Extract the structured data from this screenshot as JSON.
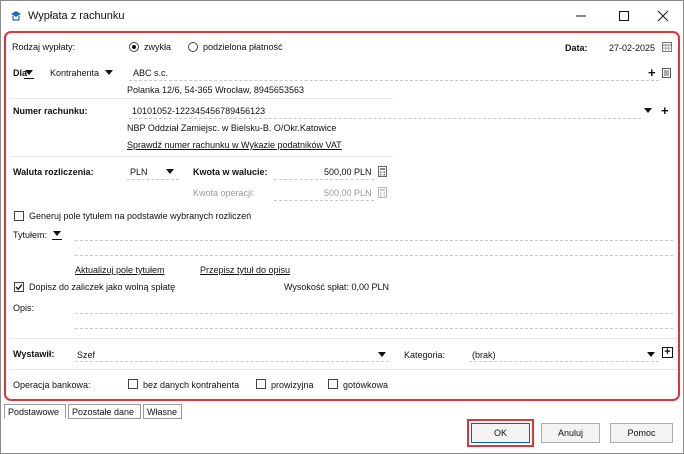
{
  "window": {
    "title": "Wypłata z rachunku"
  },
  "form": {
    "payment_type_label": "Rodzaj wypłaty:",
    "payment_type_options": [
      "zwykła",
      "podzielona płatność"
    ],
    "date_label": "Data:",
    "date_value": "27-02-2025",
    "for_label": "Dla",
    "party_type": "Kontrahenta",
    "party_name": "ABC s.c.",
    "party_address": "Polanka  12/6, 54-365 Wrocław, 8945653563",
    "account_label": "Numer rachunku:",
    "account_number": "10101052-122345456789456123",
    "bank_name": "NBP Oddział Zamiejsc. w Bielsku-B.  O/Okr.Katowice",
    "vat_check_link": "Sprawdź numer rachunku w Wykazie podatników VAT",
    "currency_label": "Waluta rozliczenia:",
    "currency_value": "PLN",
    "amount_label": "Kwota w walucie:",
    "amount_value": "500,00 PLN",
    "operation_amount_label": "Kwota operacji:",
    "operation_amount_value": "500,00 PLN",
    "generate_title_label": "Generuj pole tytułem na podstawie wybranych rozliczeń",
    "title_label": "Tytułem:",
    "update_title_link": "Aktualizuj pole tytułem",
    "copy_title_link": "Przepisz tytuł do opisu",
    "add_to_advances_label": "Dopisz do zaliczek jako wolną spłatę",
    "repayment_label": "Wysokość spłat: 0,00 PLN",
    "description_label": "Opis:",
    "issued_by_label": "Wystawił:",
    "issued_by_value": "Szef",
    "category_label": "Kategoria:",
    "category_value": "(brak)",
    "bank_operation_label": "Operacja bankowa:",
    "bank_operation_options": [
      "bez danych kontrahenta",
      "prowizyjna",
      "gotówkowa"
    ]
  },
  "tabs": [
    "Podstawowe",
    "Pozostałe dane",
    "Własne"
  ],
  "buttons": {
    "ok": "OK",
    "cancel": "Anuluj",
    "help": "Pomoc"
  },
  "colors": {
    "highlight": "#e0343b",
    "accent": "#0067c0"
  }
}
